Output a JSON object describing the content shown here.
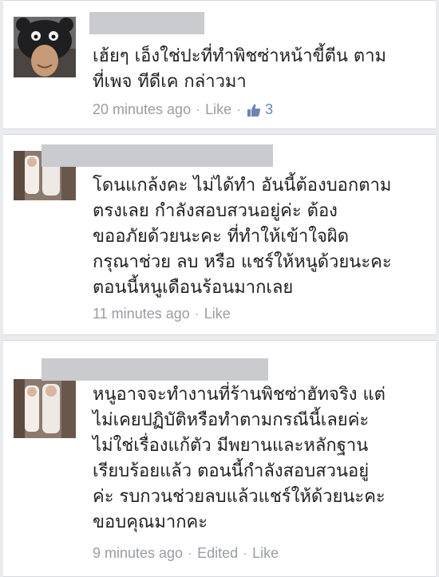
{
  "comments": [
    {
      "text": "เฮ้ยๆ เอ็งใช่ปะที่ทำพิชซ่าหน้าขี้ตีน ตาม\nที่เพจ ทีดีเค กล่าวมา",
      "time": "20 minutes ago",
      "like_label": "Like",
      "like_count": "3"
    },
    {
      "text": "โดนแกล้งคะ ไม่ได้ทำ อันนี้ต้องบอกตาม\nตรงเลย กำลังสอบสวนอยู่ค่ะ ต้อง\nขออภัยด้วยนะคะ ที่ทำให้เข้าใจผิด\nกรุณาช่วย ลบ หรือ แชร์ให้หนูด้วยนะคะ\nตอนนี้หนูเดือนร้อนมากเลย",
      "time": "11 minutes ago",
      "like_label": "Like"
    },
    {
      "text": "หนูอาจจะทำงานที่ร้านพิชซ่าฮัทจริง แต่\nไม่เคยปฏิบัติหรือทำตามกรณีนี้เลยค่ะ\nไม่ใช่เรื่องแก้ตัว มีพยานและหลักฐาน\nเรียบร้อยแล้ว ตอนนี้กำลังสอบสวนอยู่\nค่ะ รบกวนช่วยลบแล้วแชร์ให้ด้วยนะคะ\nขอบคุณมากคะ",
      "time": "9 minutes ago",
      "edited_label": "Edited",
      "like_label": "Like"
    }
  ],
  "colors": {
    "link": "#6d84b4",
    "meta": "#9a9da2",
    "redaction": "#c9cbce"
  },
  "icons": [
    "thumbs-up-icon"
  ]
}
